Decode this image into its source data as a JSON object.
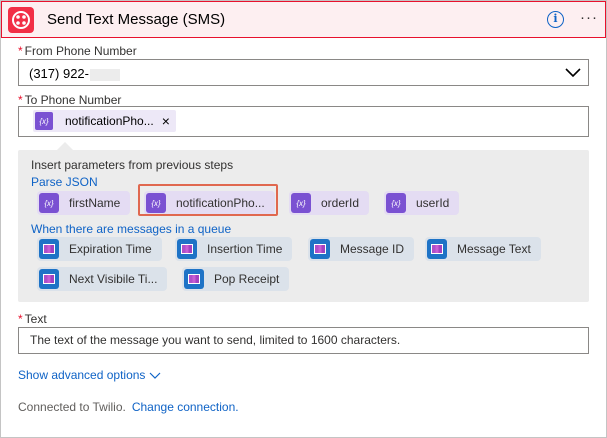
{
  "header": {
    "title": "Send Text Message (SMS)",
    "logo_icon": "twilio-logo",
    "brand_color": "#f22f46",
    "info_icon": "info-icon",
    "more_icon": "more-options-icon",
    "info_glyph": "i",
    "more_glyph": "···"
  },
  "fields": {
    "required_mark": "*",
    "from_label": "From Phone Number",
    "from_value": "(317) 922-",
    "to_label": "To Phone Number",
    "to_token": "notificationPho...",
    "to_token_remove": "×",
    "text_label": "Text",
    "text_placeholder": "The text of the message you want to send, limited to 1600 characters."
  },
  "params_panel": {
    "heading": "Insert parameters from previous steps",
    "sections": [
      {
        "name": "Parse JSON",
        "items": [
          "firstName",
          "notificationPho...",
          "orderId",
          "userId"
        ]
      },
      {
        "name": "When there are messages in a queue",
        "items": [
          "Expiration Time",
          "Insertion Time",
          "Message ID",
          "Message Text",
          "Next Visibile Ti...",
          "Pop Receipt"
        ]
      }
    ],
    "token_icon_glyph": "{x}"
  },
  "footer": {
    "advanced": "Show advanced options",
    "connected": "Connected to Twilio.",
    "change": "Change connection."
  },
  "colors": {
    "accent": "#0f63c6",
    "required": "#e8112d",
    "header_bg": "#fdeff1",
    "token_purple": "#7a51d2",
    "highlight": "#e0684f"
  }
}
